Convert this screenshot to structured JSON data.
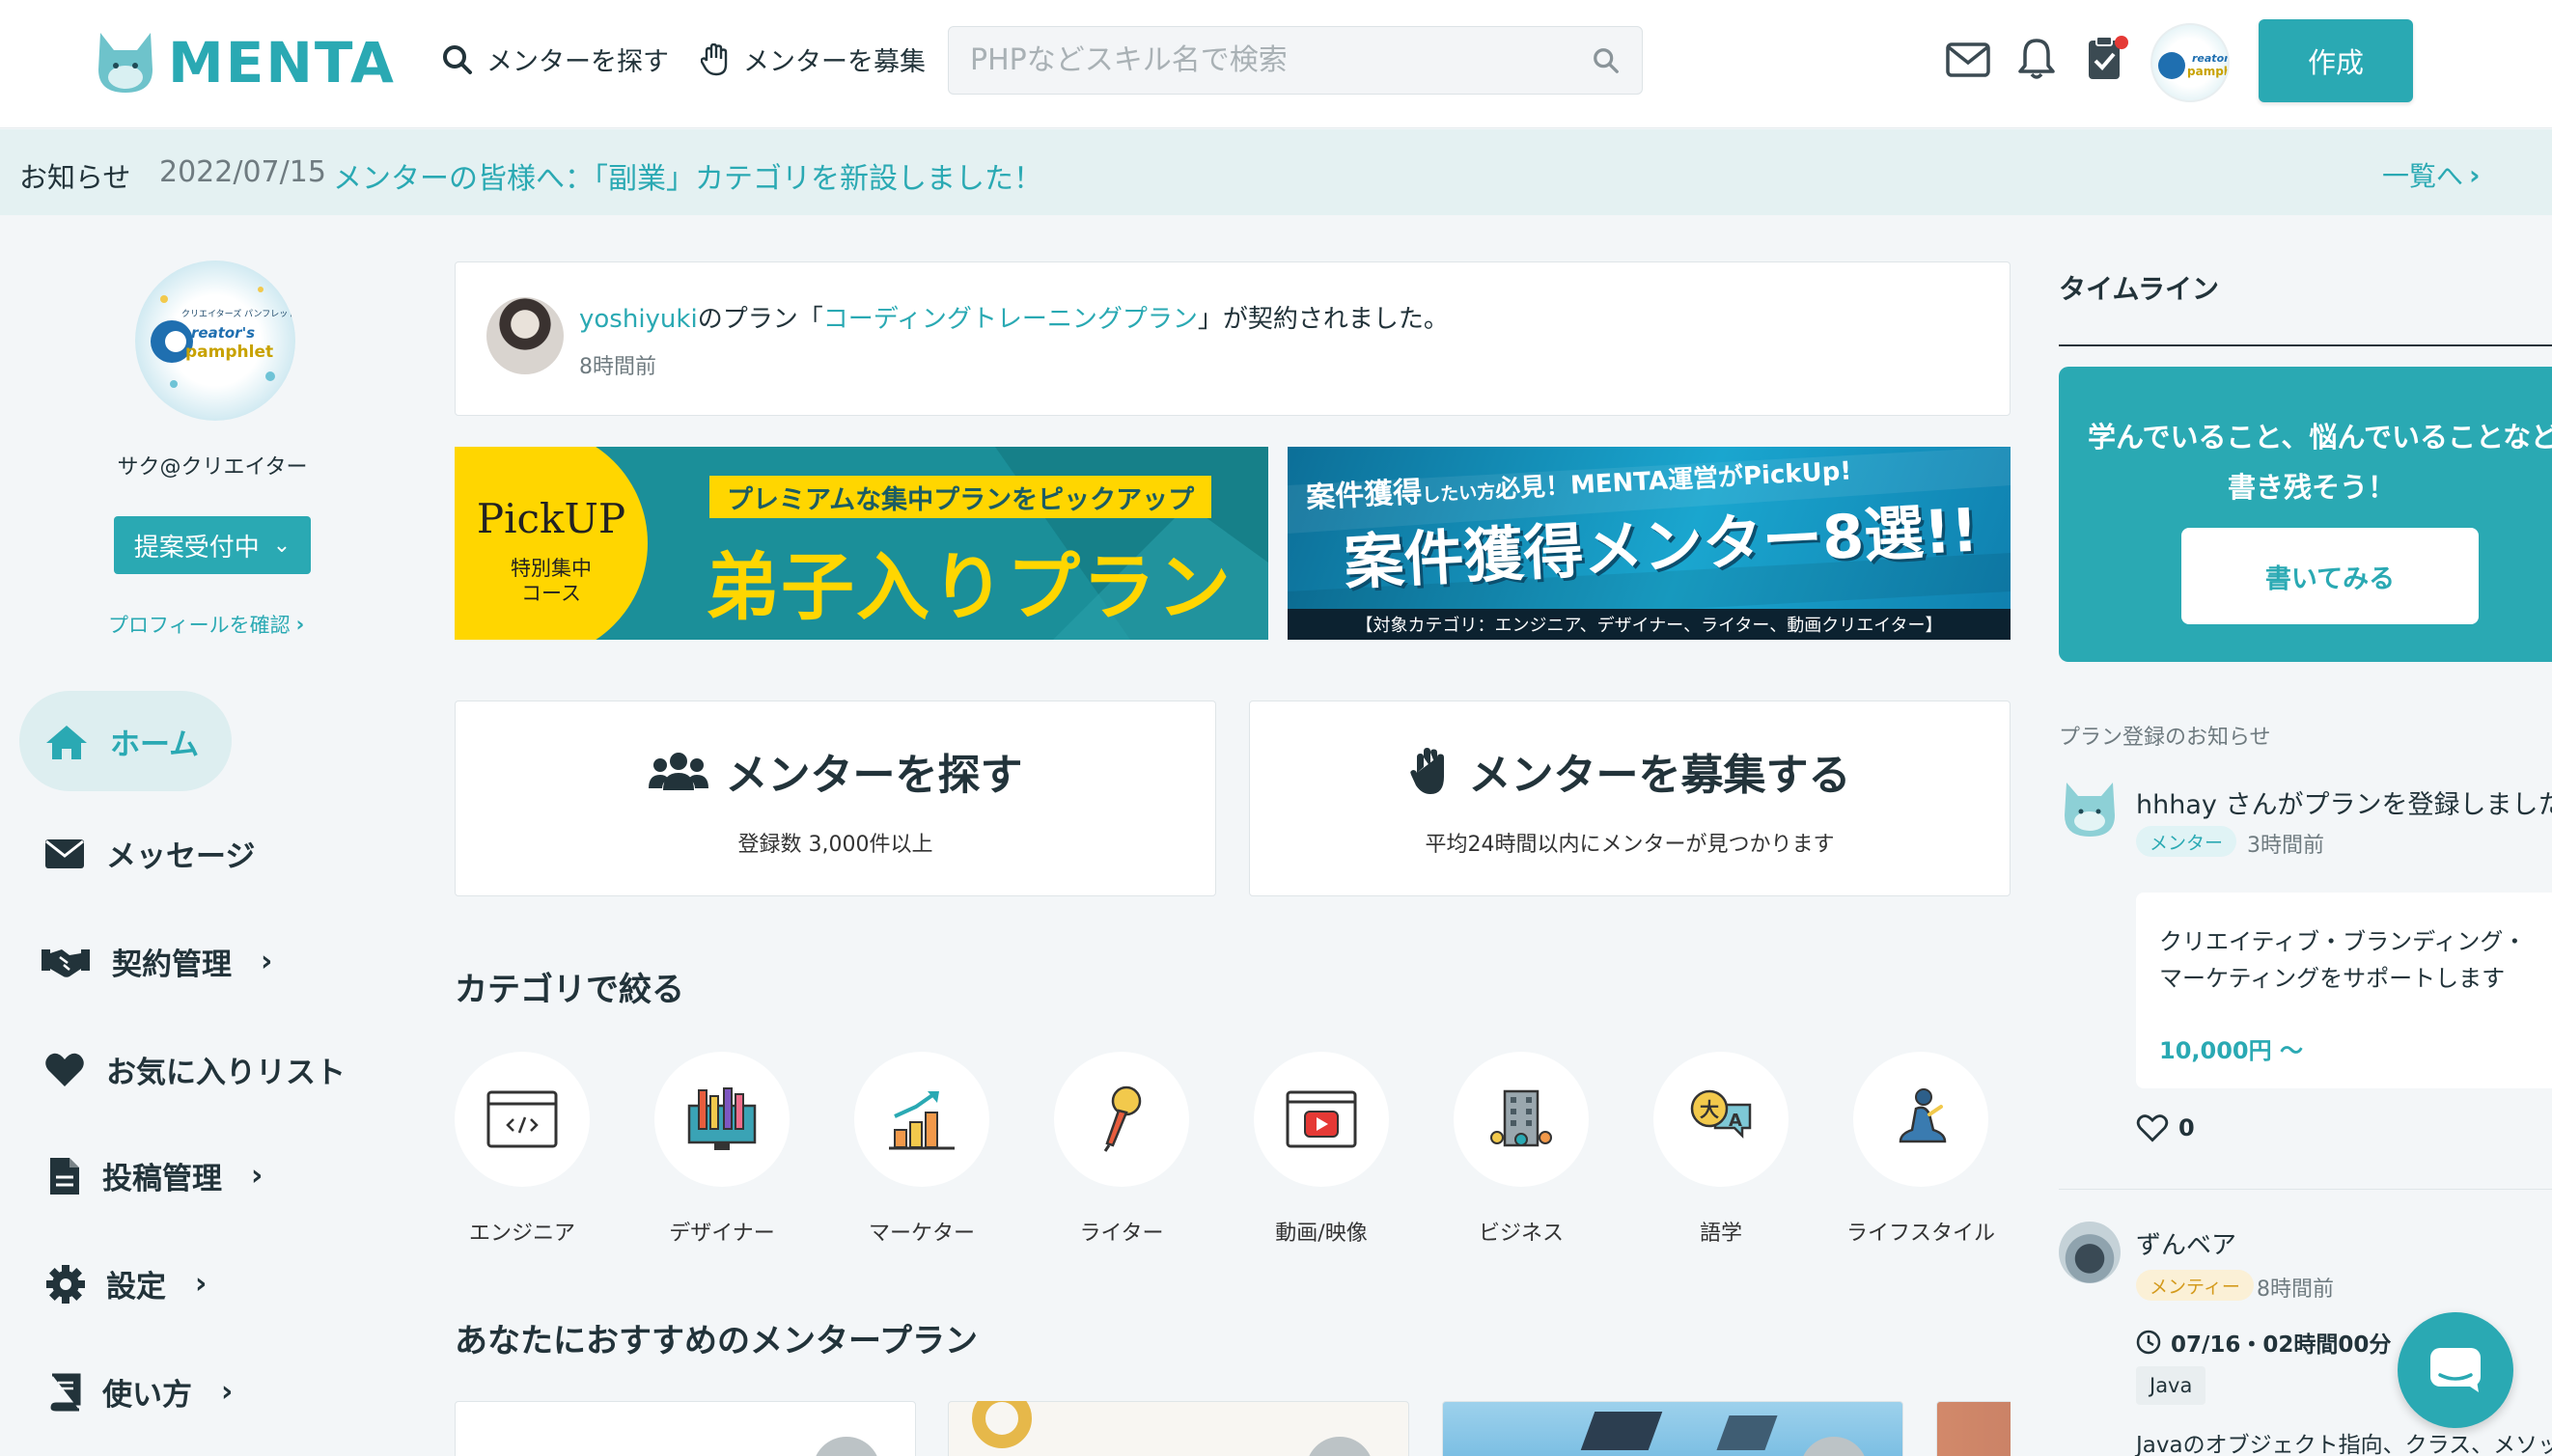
{
  "header": {
    "logo_text": "MENTA",
    "nav_find_mentor": "メンターを探す",
    "nav_recruit_mentor": "メンターを募集",
    "search_placeholder": "PHPなどスキル名で検索",
    "create_label": "作成",
    "user_avatar_text": "creator's pamphlet",
    "notification_dot_color": "#e53935"
  },
  "notice": {
    "label": "お知らせ",
    "date": "2022/07/15",
    "message": "メンターの皆様へ：「副業」カテゴリを新設しました！",
    "list_link": "一覧へ"
  },
  "sidebar": {
    "profile_name": "サク@クリエイター",
    "avatar_text_top": "クリエイターズ パンフレット",
    "avatar_text_main": "creator's pamphlet",
    "status_button": "提案受付中",
    "profile_link": "プロフィールを確認",
    "items": [
      {
        "label": "ホーム",
        "icon": "home-icon",
        "active": true
      },
      {
        "label": "メッセージ",
        "icon": "envelope-icon"
      },
      {
        "label": "契約管理",
        "icon": "handshake-icon"
      },
      {
        "label": "お気に入りリスト",
        "icon": "heart-icon"
      },
      {
        "label": "投稿管理",
        "icon": "document-icon"
      },
      {
        "label": "設定",
        "icon": "gear-icon"
      },
      {
        "label": "使い方",
        "icon": "book-icon"
      }
    ]
  },
  "activity": {
    "user": "yoshiyuki",
    "text1": "のプラン「",
    "plan": "コーディングトレーニングプラン",
    "text2": "」が契約されました。",
    "time": "8時間前"
  },
  "banners": {
    "left": {
      "badge_title": "PickUP",
      "badge_sub1": "特別集中",
      "badge_sub2": "コース",
      "ribbon": "プレミアムな集中プランをピックアップ",
      "headline": "弟子入りプラン"
    },
    "right": {
      "top_a": "案件獲得",
      "top_b": "したい方",
      "top_c": "必見！MENTA運営がPickUp!",
      "headline": "案件獲得メンター8選!!",
      "footer": "【対象カテゴリ：エンジニア、デザイナー、ライター、動画クリエイター】"
    }
  },
  "actions": {
    "find": {
      "title": "メンターを探す",
      "sub": "登録数 3,000件以上"
    },
    "recruit": {
      "title": "メンターを募集する",
      "sub": "平均24時間以内にメンターが見つかります"
    }
  },
  "categories": {
    "heading": "カテゴリで絞る",
    "items": [
      {
        "label": "エンジニア",
        "icon": "code-window-icon"
      },
      {
        "label": "デザイナー",
        "icon": "design-tools-icon"
      },
      {
        "label": "マーケター",
        "icon": "growth-chart-icon"
      },
      {
        "label": "ライター",
        "icon": "pen-nib-icon"
      },
      {
        "label": "動画/映像",
        "icon": "video-player-icon"
      },
      {
        "label": "ビジネス",
        "icon": "office-building-icon"
      },
      {
        "label": "語学",
        "icon": "language-bubbles-icon"
      },
      {
        "label": "ライフスタイル",
        "icon": "yoga-icon"
      }
    ]
  },
  "recommend": {
    "heading": "あなたにおすすめのメンタープラン"
  },
  "timeline": {
    "title": "タイムライン",
    "cta_text": "学んでいること、悩んでいることなど",
    "cta_text2": "書き残そう！",
    "cta_button": "書いてみる",
    "plan_notice_label": "プラン登録のお知らせ",
    "post1": {
      "user_text": "hhhay さんがプランを登録しました!",
      "role": "メンター",
      "time": "3時間前",
      "plan_title": "クリエイティブ・ブランディング・マーケティングをサポートします",
      "price": "10,000円 〜",
      "likes": "0"
    },
    "post2": {
      "user": "ずんベア",
      "role": "メンティー",
      "time": "8時間前",
      "schedule": "07/16・02時間00分",
      "tag": "Java",
      "text": "Javaのオブジェクト指向、クラス、メソッドの"
    }
  },
  "colors": {
    "brand": "#2aa9b3",
    "notice_bg": "#e4f1f2",
    "banner_yellow": "#ffd600",
    "banner_teal": "#1b8f99"
  }
}
